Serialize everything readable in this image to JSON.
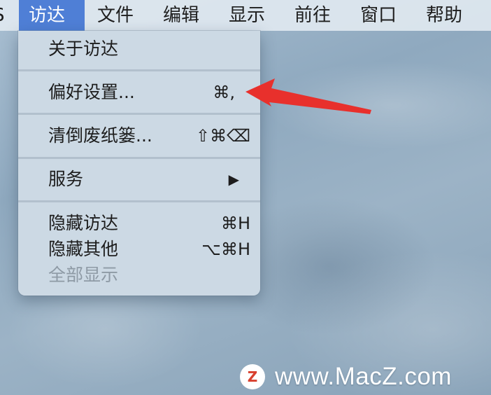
{
  "menubar": {
    "edge_fragment": "S",
    "items": [
      "访达",
      "文件",
      "编辑",
      "显示",
      "前往",
      "窗口",
      "帮助"
    ],
    "active_item": "访达"
  },
  "finder_menu": {
    "items": [
      {
        "label": "关于访达",
        "shortcut": "",
        "enabled": true
      },
      {
        "label": "偏好设置...",
        "shortcut": "⌘,",
        "enabled": true
      },
      {
        "label": "清倒废纸篓...",
        "shortcut": "⇧⌘⌫",
        "enabled": true
      },
      {
        "label": "服务",
        "shortcut": "▶",
        "enabled": true
      },
      {
        "label": "隐藏访达",
        "shortcut": "⌘H",
        "enabled": true
      },
      {
        "label": "隐藏其他",
        "shortcut": "⌥⌘H",
        "enabled": true
      },
      {
        "label": "全部显示",
        "shortcut": "",
        "enabled": false
      }
    ]
  },
  "annotation": {
    "arrow_color": "#e8302c",
    "points_to": "偏好设置..."
  },
  "watermark": {
    "logo_letter": "Z",
    "text": "www.MacZ.com"
  }
}
